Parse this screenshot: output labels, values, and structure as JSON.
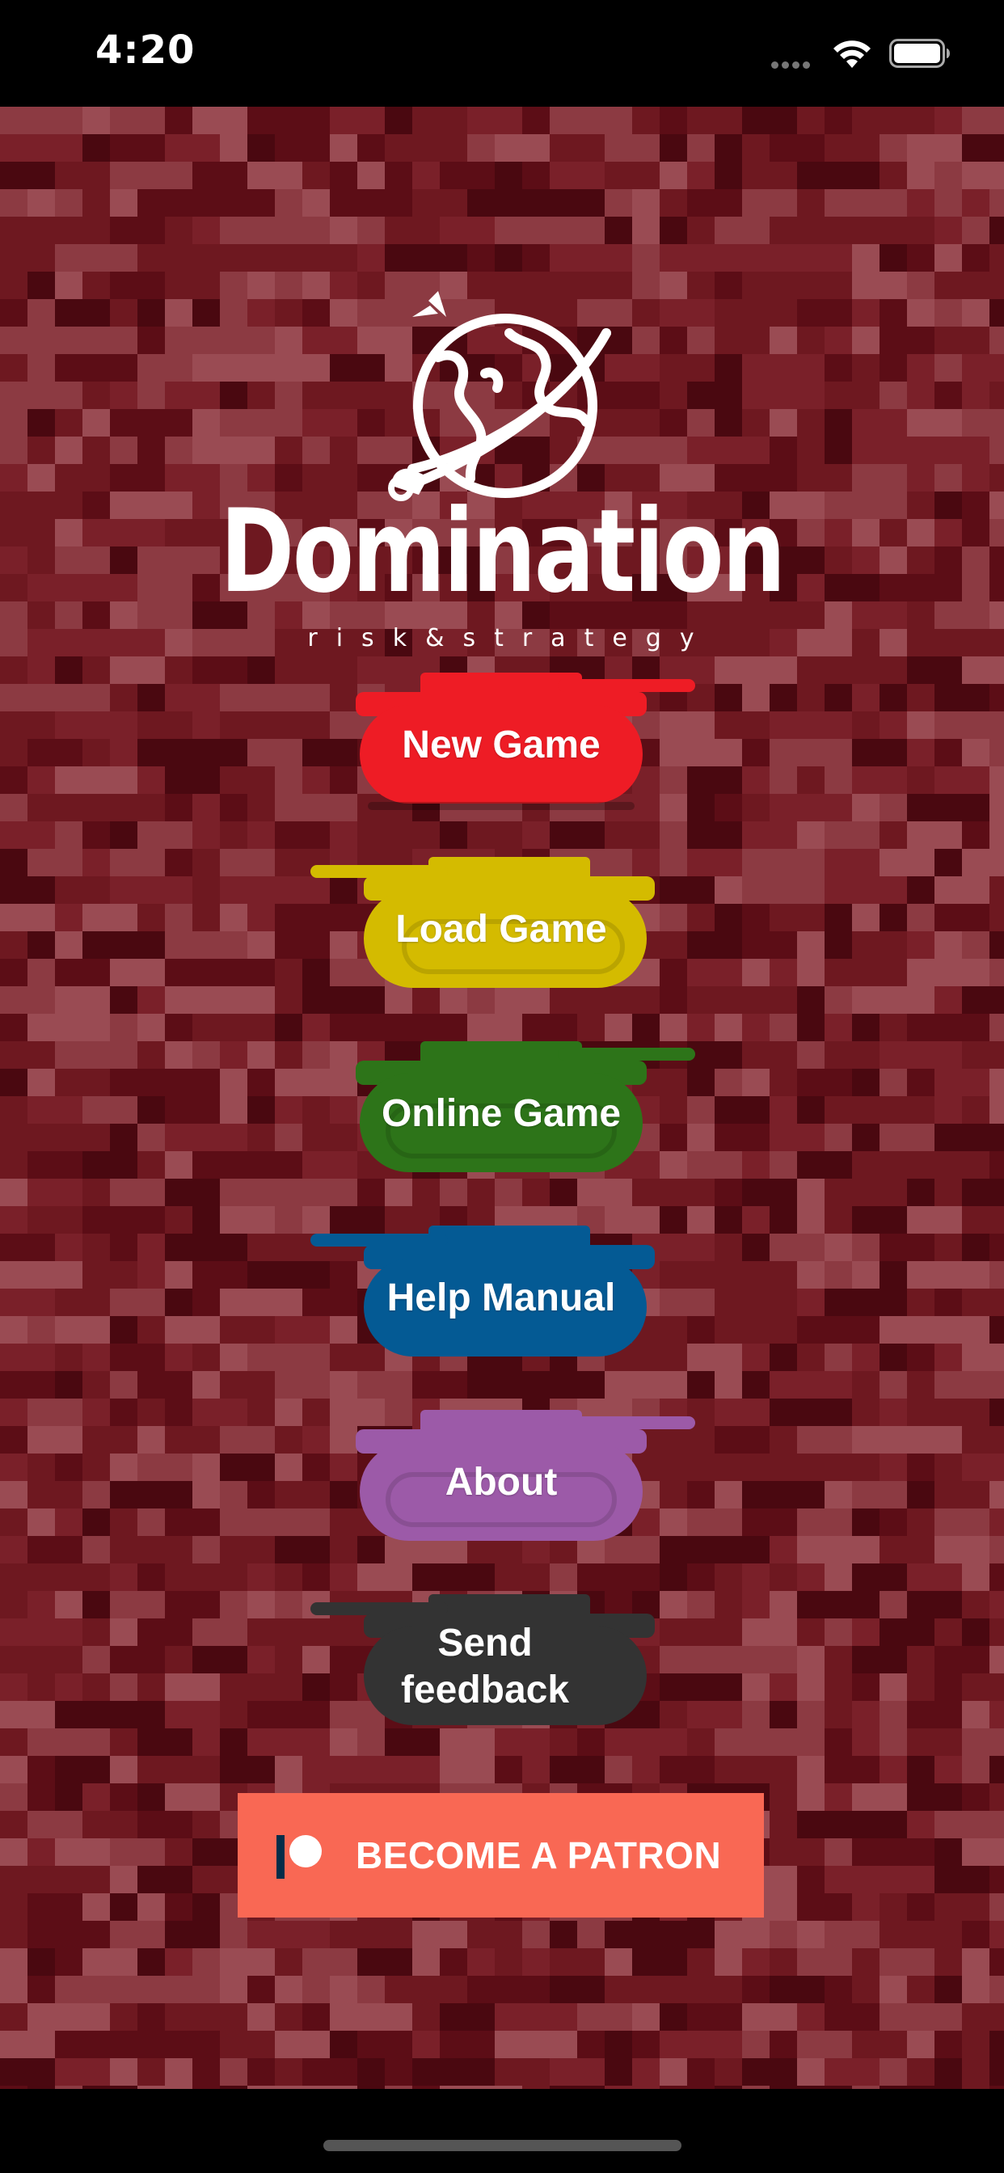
{
  "status_bar": {
    "time": "4:20",
    "icons": [
      "signal-dots-icon",
      "wifi-icon",
      "battery-icon"
    ]
  },
  "logo": {
    "title": "Domination",
    "subtitle": "risk&strategy",
    "icon": "globe-plane-icon"
  },
  "menu": {
    "new_game": "New Game",
    "load_game": "Load Game",
    "online_game": "Online Game",
    "help_manual": "Help Manual",
    "about": "About",
    "send_feedback": "Send feedback"
  },
  "patron": {
    "label": "BECOME A PATRON",
    "icon": "patreon-icon"
  },
  "colors": {
    "camo_base": "#6e1820",
    "new_game": "#ee1c25",
    "load_game": "#d4bb00",
    "online_game": "#2d7419",
    "help_manual": "#045a94",
    "about": "#9c5aa8",
    "send_feedback": "#333333",
    "patron": "#f96854"
  }
}
